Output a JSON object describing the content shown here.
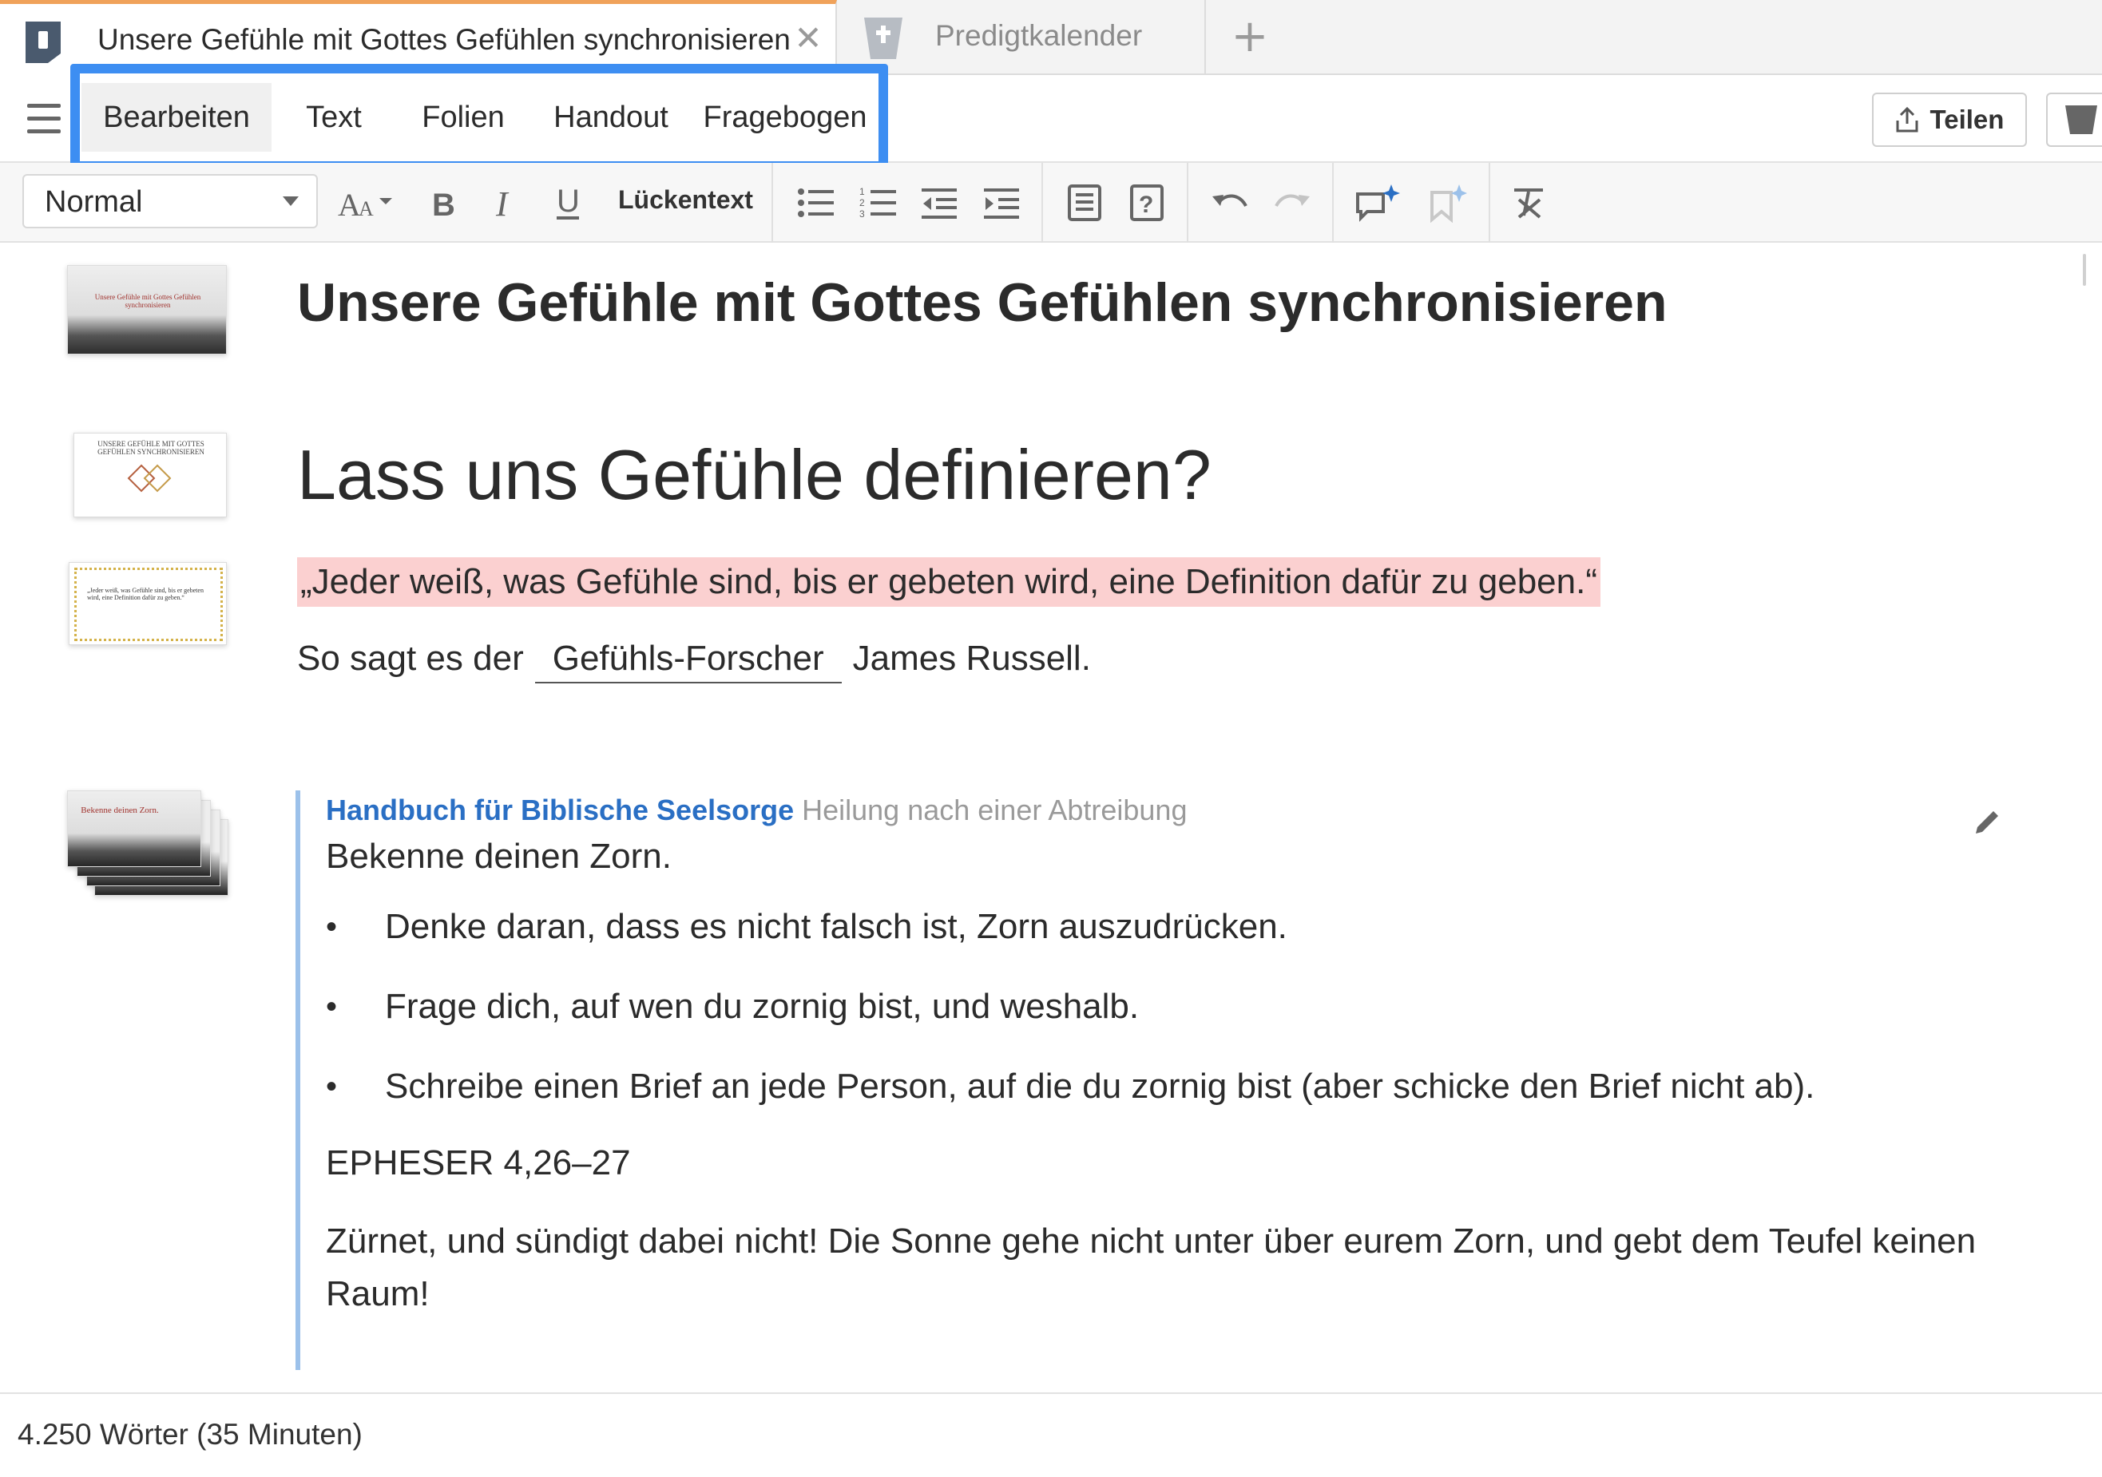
{
  "tabs": [
    {
      "title": "Unsere Gefühle mit Gottes Gefühlen synchronisieren",
      "close_glyph": "✕",
      "active": true
    },
    {
      "title": "Predigtkalender",
      "active": false
    }
  ],
  "tab_add_glyph": "+",
  "menu": {
    "tabs": [
      "Bearbeiten",
      "Text",
      "Folien",
      "Handout",
      "Fragebogen"
    ],
    "active_tab": "Bearbeiten",
    "highlight_color": "#3d8ef2",
    "share_label": "Teilen"
  },
  "toolbar": {
    "style_value": "Normal",
    "cloze_label": "Lückentext",
    "icons": [
      "font-size-icon",
      "bold-icon",
      "italic-icon",
      "underline-icon",
      "bullet-list-icon",
      "numbered-list-icon",
      "outdent-icon",
      "indent-icon",
      "block-icon",
      "question-icon",
      "undo-icon",
      "redo-icon",
      "ai-comment-icon",
      "ai-bookmark-icon",
      "clear-format-icon"
    ]
  },
  "document": {
    "title": "Unsere Gefühle mit Gottes Gefühlen synchronisieren",
    "heading": "Lass uns Gefühle definieren?",
    "quote": "„Jeder weiß, was Gefühle sind, bis er gebeten wird, eine Definition dafür zu geben.“",
    "quote_highlight": "#fbd0d0",
    "sentence_before": "So sagt es der",
    "sentence_blank": "Gefühls-Forscher",
    "sentence_after": "James Russell.",
    "resource": {
      "source": "Handbuch für Biblische Seelsorge",
      "subtitle": "Heilung nach einer Abtreibung",
      "intro": "Bekenne deinen Zorn.",
      "bullets": [
        "Denke daran, dass es nicht falsch ist, Zorn auszudrücken.",
        "Frage dich, auf wen du zornig bist, und weshalb.",
        "Schreibe einen Brief an jede Person, auf die du zornig bist (aber schicke den Brief nicht ab)."
      ],
      "verse_ref": "EPHESER 4,26–27",
      "verse_text": "Zürnet, und sündigt dabei nicht! Die Sonne gehe nicht unter über eurem Zorn, und gebt dem Teufel keinen Raum!"
    },
    "slides": [
      {
        "text": "Unsere Gefühle mit Gottes Gefühlen synchronisieren"
      },
      {
        "text": "UNSERE GEFÜHLE MIT GOTTES GEFÜHLEN SYNCHRONISIEREN"
      },
      {
        "text": "„Jeder weiß, was Gefühle sind, bis er gebeten wird, eine Definition dafür zu geben.“"
      },
      {
        "text": "Bekenne deinen Zorn."
      }
    ]
  },
  "status": {
    "word_count": "4.250 Wörter (35 Minuten)"
  }
}
